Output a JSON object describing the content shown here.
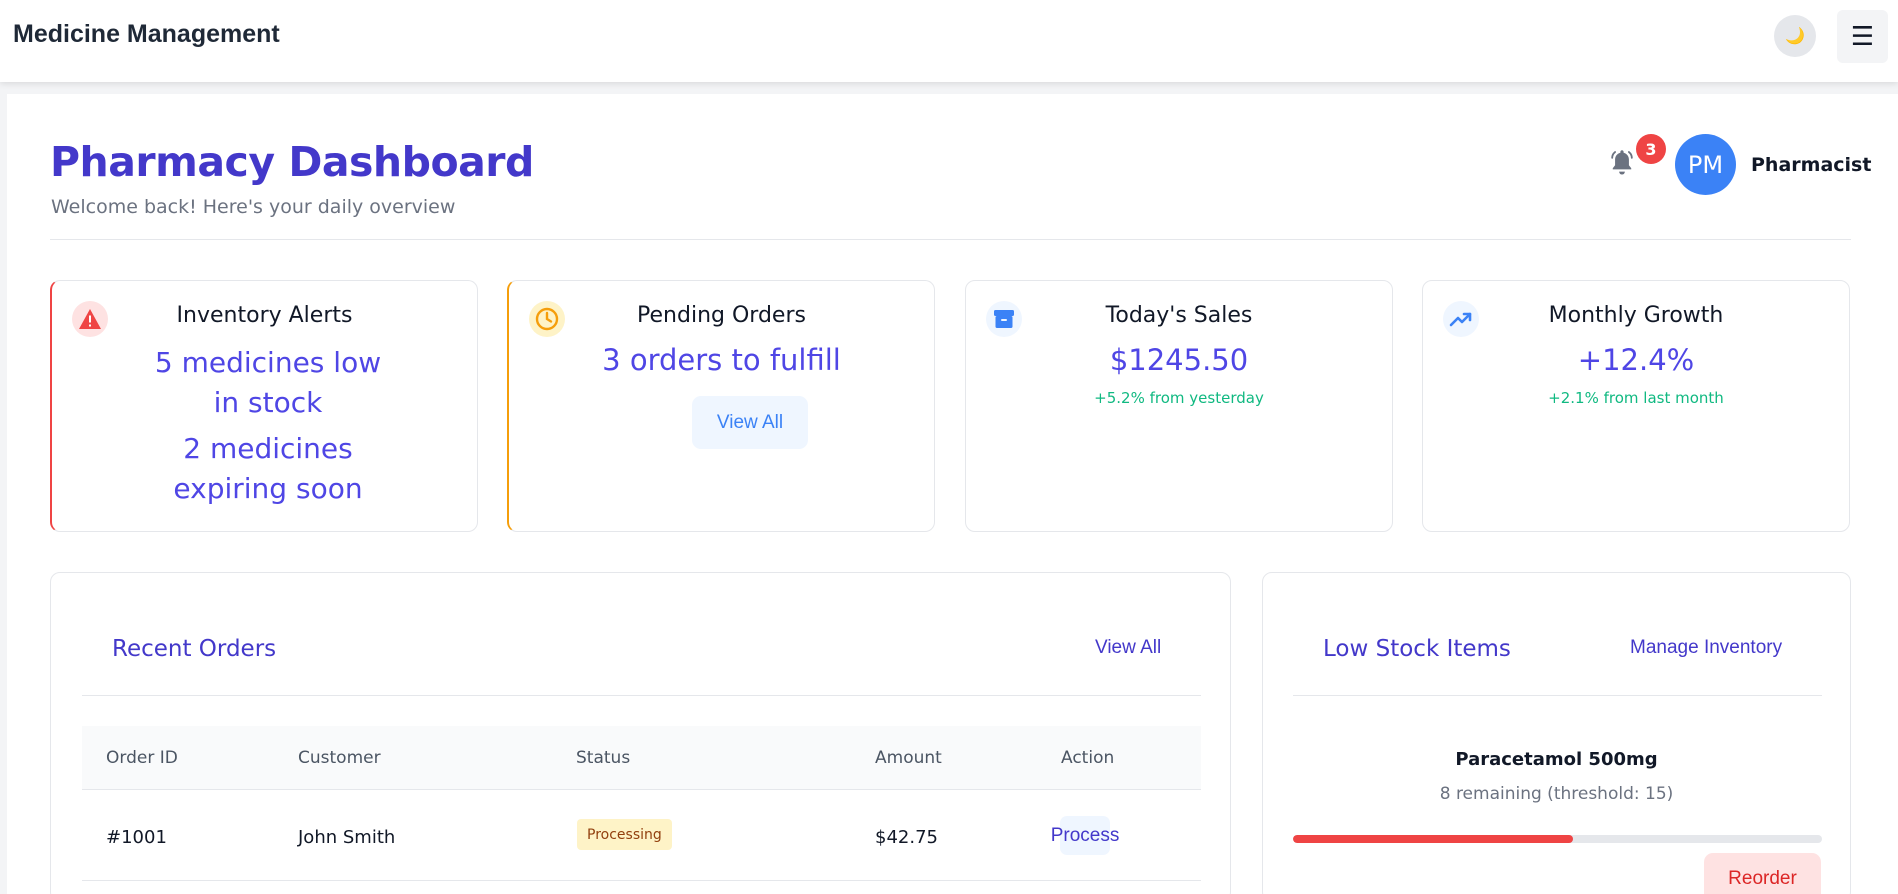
{
  "topbar": {
    "title": "Medicine Management",
    "theme_toggle_glyph": "🌙",
    "menu_glyph": "☰"
  },
  "header": {
    "title": "Pharmacy Dashboard",
    "subtitle": "Welcome back! Here's your daily overview",
    "notification_count": "3",
    "avatar_initials": "PM",
    "role": "Pharmacist"
  },
  "cards": {
    "inventory": {
      "title": "Inventory Alerts",
      "line1": "5 medicines low in stock",
      "line2": "2 medicines expiring soon",
      "icon": "warning-icon",
      "accent": "#ef4444"
    },
    "pending": {
      "title": "Pending Orders",
      "value": "3 orders to fulfill",
      "button": "View All",
      "icon": "clock-icon",
      "accent": "#f59e0b"
    },
    "sales": {
      "title": "Today's Sales",
      "value": "$1245.50",
      "note": "+5.2% from yesterday",
      "icon": "archive-icon",
      "accent": "#3b82f6"
    },
    "growth": {
      "title": "Monthly Growth",
      "value": "+12.4%",
      "note": "+2.1% from last month",
      "icon": "trending-up-icon",
      "accent": "#3b82f6"
    }
  },
  "recent_orders": {
    "title": "Recent Orders",
    "link": "View All",
    "columns": [
      "Order ID",
      "Customer",
      "Status",
      "Amount",
      "Action"
    ],
    "rows": [
      {
        "id": "#1001",
        "customer": "John Smith",
        "status": "Processing",
        "amount": "$42.75",
        "action": "Process"
      }
    ]
  },
  "low_stock": {
    "title": "Low Stock Items",
    "link": "Manage Inventory",
    "items": [
      {
        "name": "Paracetamol 500mg",
        "remaining_text": "8 remaining (threshold: 15)",
        "stock_fraction": 0.53,
        "button": "Reorder"
      }
    ]
  },
  "colors": {
    "brand": "#4338ca",
    "accent_value": "#4f46e5",
    "positive": "#10b981",
    "danger": "#ef4444"
  }
}
